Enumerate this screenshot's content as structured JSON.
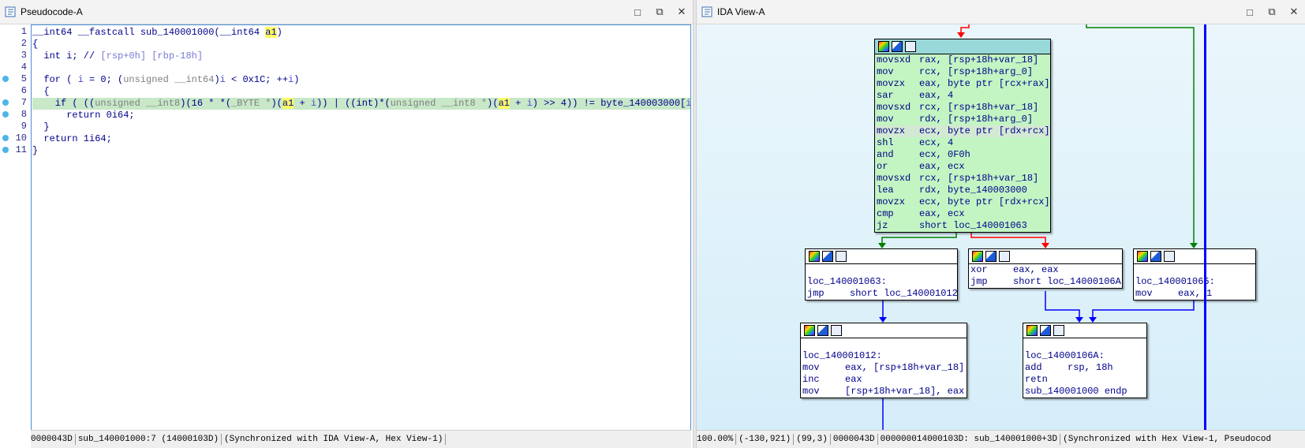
{
  "pseudocode": {
    "title": "Pseudocode-A",
    "lines": [
      {
        "n": "1",
        "dot": false
      },
      {
        "n": "2",
        "dot": false
      },
      {
        "n": "3",
        "dot": false
      },
      {
        "n": "4",
        "dot": false
      },
      {
        "n": "5",
        "dot": true
      },
      {
        "n": "6",
        "dot": false
      },
      {
        "n": "7",
        "dot": true
      },
      {
        "n": "8",
        "dot": true
      },
      {
        "n": "9",
        "dot": false
      },
      {
        "n": "10",
        "dot": true
      },
      {
        "n": "11",
        "dot": true
      }
    ],
    "code": {
      "l1a": "__int64 __fastcall sub_140001000(__int64 ",
      "l1var": "a1",
      "l1b": ")",
      "l2": "{",
      "l3a": "  int i; // ",
      "l3c": "[rsp+0h] [rbp-18h]",
      "l5a": "  for ( ",
      "l5i": "i",
      "l5b": " = 0; (",
      "l5t": "unsigned __int64",
      "l5c": ")",
      "l5d": " < 0x1C; ++",
      "l5e": ")",
      "l6": "  {",
      "l7a": "    if ( ((",
      "l7t1": "unsigned __int8",
      "l7b": ")(16 * *(",
      "l7t2": "_BYTE *",
      "l7c": ")(",
      "l7v1": "a1",
      "l7d": " + ",
      "l7e": ")) | ((int)*(",
      "l7t3": "unsigned __int8 *",
      "l7f": ")(",
      "l7v2": "a1",
      "l7g": " + ",
      "l7h": ") >> 4)) != ",
      "l7gv": "byte_140003000",
      "l7k": "[",
      "l7m": "] )",
      "l8": "      return 0i64;",
      "l9": "  }",
      "l10": "  return 1i64;",
      "l11": "}"
    },
    "status": [
      "0000043D",
      "sub_140001000:7 (14000103D)",
      "(Synchronized with IDA View-A, Hex View-1)"
    ]
  },
  "ida": {
    "title": "IDA View-A",
    "main_block": [
      [
        "movsxd",
        "rax, [rsp+18h+var_18]"
      ],
      [
        "mov",
        "rcx, [rsp+18h+arg_0]"
      ],
      [
        "movzx",
        "eax, byte ptr [rcx+rax]"
      ],
      [
        "sar",
        "eax, 4"
      ],
      [
        "movsxd",
        "rcx, [rsp+18h+var_18]"
      ],
      [
        "mov",
        "rdx, [rsp+18h+arg_0]"
      ],
      [
        "movzx",
        "ecx, byte ptr [rdx+rcx]"
      ],
      [
        "shl",
        "ecx, 4"
      ],
      [
        "and",
        "ecx, 0F0h"
      ],
      [
        "or",
        "eax, ecx"
      ],
      [
        "movsxd",
        "rcx, [rsp+18h+var_18]"
      ],
      [
        "lea",
        "rdx, byte_140003000"
      ],
      [
        "movzx",
        "ecx, byte ptr [rdx+rcx]"
      ],
      [
        "cmp",
        "eax, ecx"
      ],
      [
        "jz",
        "short loc_140001063"
      ]
    ],
    "block_063": {
      "label": "loc_140001063:",
      "line": [
        "jmp",
        "short loc_140001012"
      ]
    },
    "block_xor": [
      [
        "xor",
        "eax, eax"
      ],
      [
        "jmp",
        "short loc_14000106A"
      ]
    ],
    "block_065": {
      "label": "loc_140001065:",
      "line": [
        "mov",
        "eax, 1"
      ]
    },
    "block_012": {
      "label": "loc_140001012:",
      "lines": [
        [
          "mov",
          "eax, [rsp+18h+var_18]"
        ],
        [
          "inc",
          "eax"
        ],
        [
          "mov",
          "[rsp+18h+var_18], eax"
        ]
      ]
    },
    "block_06a": {
      "label": "loc_14000106A:",
      "lines": [
        [
          "add",
          "rsp, 18h"
        ],
        [
          "retn",
          ""
        ]
      ],
      "endp": "sub_140001000 endp"
    },
    "status": [
      "100.00%",
      "(-130,921)",
      "(99,3)",
      "0000043D",
      "000000014000103D: sub_140001000+3D",
      "(Synchronized with Hex View-1, Pseudocod"
    ]
  },
  "colors": {
    "green_edge": "#008000",
    "red_edge": "#ff0000",
    "blue_edge": "#0000ff",
    "current_block": "#c2f5c2"
  }
}
